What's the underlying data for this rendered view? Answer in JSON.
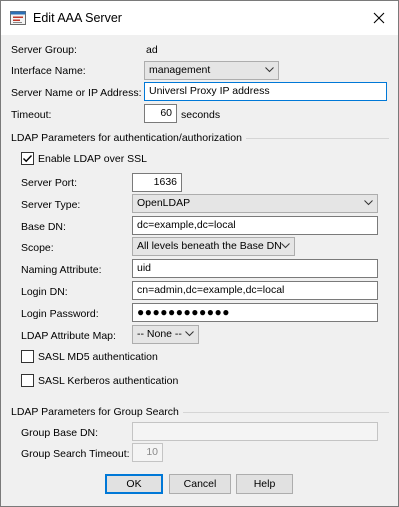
{
  "window": {
    "title": "Edit AAA Server",
    "icons": {
      "app": "app-window-icon",
      "close": "close-icon"
    }
  },
  "form": {
    "server_group": {
      "label": "Server Group:",
      "value": "ad"
    },
    "interface_name": {
      "label": "Interface Name:",
      "value": "management"
    },
    "server_name": {
      "label": "Server Name or IP Address:",
      "value": "Universl Proxy IP address"
    },
    "timeout": {
      "label": "Timeout:",
      "value": "60",
      "unit": "seconds"
    }
  },
  "ldap": {
    "group_title": "LDAP Parameters for authentication/authorization",
    "enable_ssl": {
      "label": "Enable LDAP over SSL",
      "checked": true
    },
    "server_port": {
      "label": "Server Port:",
      "value": "1636"
    },
    "server_type": {
      "label": "Server Type:",
      "value": "OpenLDAP"
    },
    "base_dn": {
      "label": "Base DN:",
      "value": "dc=example,dc=local"
    },
    "scope": {
      "label": "Scope:",
      "value": "All levels beneath the Base DN"
    },
    "naming_attribute": {
      "label": "Naming Attribute:",
      "value": "uid"
    },
    "login_dn": {
      "label": "Login DN:",
      "value": "cn=admin,dc=example,dc=local"
    },
    "login_password": {
      "label": "Login Password:",
      "value": "●●●●●●●●●●●●"
    },
    "attribute_map": {
      "label": "LDAP Attribute Map:",
      "value": "-- None --"
    },
    "sasl_md5": {
      "label": "SASL MD5 authentication",
      "checked": false
    },
    "sasl_kerberos": {
      "label": "SASL Kerberos authentication",
      "checked": false
    }
  },
  "group_search": {
    "group_title": "LDAP Parameters for Group Search",
    "group_base_dn": {
      "label": "Group Base DN:",
      "value": ""
    },
    "timeout": {
      "label": "Group Search Timeout:",
      "value": "10"
    }
  },
  "buttons": {
    "ok": "OK",
    "cancel": "Cancel",
    "help": "Help"
  }
}
